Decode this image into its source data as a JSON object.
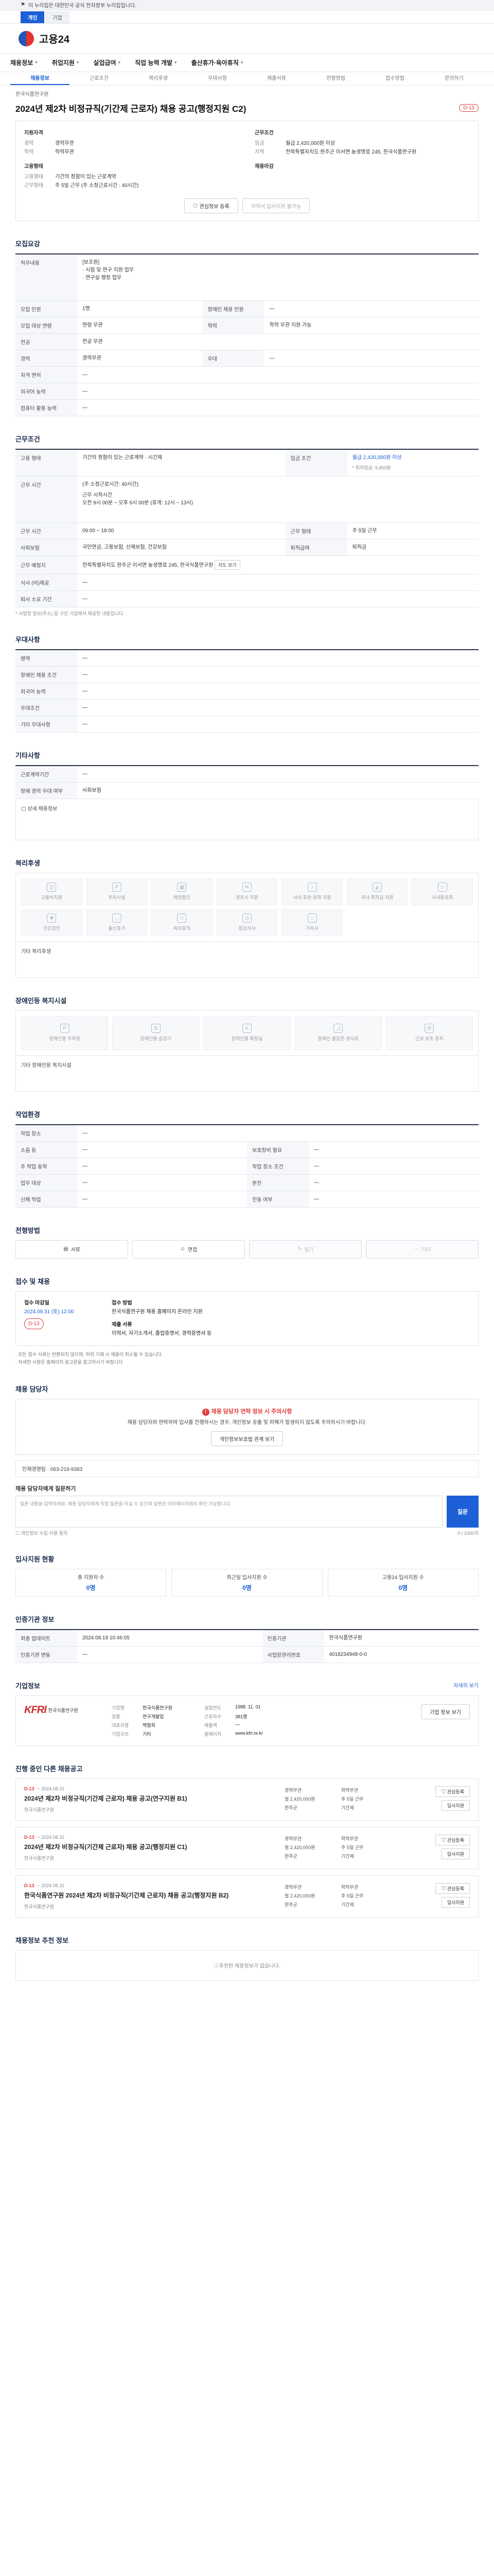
{
  "banner": {
    "text": "이 누리집은 대한민국 공식 전자정부 누리집입니다."
  },
  "util_tabs": [
    "개인",
    "기업"
  ],
  "header": {
    "logo": "고용24"
  },
  "gnb": [
    "채용정보",
    "취업지원",
    "실업급여",
    "직업 능력 개발",
    "출산휴가·육아휴직"
  ],
  "subtabs": [
    "채용정보",
    "근로조건",
    "복리후생",
    "우대사항",
    "제출서류",
    "전형방법",
    "접수방법",
    "문의하기"
  ],
  "posting": {
    "company_sm": "한국식품연구원",
    "title": "2024년 제2차 비정규직(기간제 근로자) 채용 공고(행정지원 C2)",
    "dday": "D-13"
  },
  "summary": {
    "left_label": "지원자격",
    "left": [
      {
        "k": "경력",
        "v": "경력무관"
      },
      {
        "k": "학력",
        "v": "학력무관"
      }
    ],
    "left2_label": "고용형태",
    "left2": [
      {
        "k": "고용형태",
        "v": "기간의 정함이 있는 근로계약"
      },
      {
        "k": "근무형태",
        "v": "주 5일 근무 (주 소정근로시간 : 40시간)"
      }
    ],
    "right_label": "근무조건",
    "right": [
      {
        "k": "임금",
        "v": "월급 2,420,000원 이상"
      },
      {
        "k": "지역",
        "v": "전북특별자치도 완주군 이서면 농생명로 245, 한국식품연구원"
      }
    ],
    "right2_label": "채용마감",
    "interest_btn": "관심정보 등록",
    "resume_btn": "이력서 입사지원 불가능"
  },
  "sections": {
    "recruit": "모집요강",
    "work": "근무조건",
    "prefer": "우대사항",
    "etc": "기타사항",
    "welfare": "복리후생",
    "disability": "장애인등 복지시설",
    "workplace": "작업환경",
    "selection": "전형방법",
    "apply": "접수 및 채용",
    "inquiry": "채용 담당자",
    "applicants": "입사지원 현황",
    "status": "인증기관 정보",
    "company": "기업정보",
    "other_jobs": "진행 중인 다른 채용공고",
    "recommend": "채용정보 추천 정보"
  },
  "recruit_table": [
    {
      "k": "직무내용",
      "v": "[보조원]\n· 시험 및 연구 지원 업무\n· 연구실 행정 업무"
    },
    {
      "k": "모집 인원",
      "v": "1명"
    },
    {
      "k": "모집 대상 연령",
      "v": "연령 무관"
    },
    {
      "k": "전공",
      "v": "전공 무관"
    },
    {
      "k": "경력",
      "v": "경력무관"
    },
    {
      "k": "자격 면허",
      "v": "—"
    },
    {
      "k": "외국어 능력",
      "v": "—"
    },
    {
      "k": "컴퓨터 활용 능력",
      "v": "—"
    }
  ],
  "recruit_right": [
    {
      "k": "장애인 채용 인원",
      "v": "—"
    },
    {
      "k": "학력",
      "v": "학력 무관 지원 가능"
    },
    {
      "k": "우대",
      "v": "—"
    }
  ],
  "work_table": [
    {
      "k": "고용 형태",
      "v": "기간의 정함이 있는 근로계약 · 시간제"
    },
    {
      "k": "임금 조건",
      "v": "월급 2,420,000원 이상"
    },
    {
      "k": "근무 예정지",
      "v": "전북특별자치도 완주군 이서면 농생명로 245, 한국식품연구원"
    },
    {
      "k": "근무 시간",
      "v": "09:00 ~ 18:00"
    },
    {
      "k": "근무 형태",
      "v": "주 5일 근무"
    },
    {
      "k": "사회보험",
      "v": "국민연금, 고용보험, 산재보험, 건강보험"
    },
    {
      "k": "퇴직급여",
      "v": "퇴직금"
    },
    {
      "k": "식사 (비)제공",
      "v": "—"
    },
    {
      "k": "퇴사 소요 기간",
      "v": "—"
    }
  ],
  "work_extra": {
    "pay_note": "* 최저임금: 9,860원",
    "schedule_note": "(주 소정근로시간: 40시간)",
    "time_detail": "근무 시작시간\n오전 9시 00분 ~ 오후 6시 00분 (휴게: 12시 ~ 13시)",
    "map_btn": "지도 보기",
    "footnote": "* 사업장 정보(주소) 등 구인 기업에서 제공한 내용입니다."
  },
  "prefer_table": [
    {
      "k": "병역",
      "v": "—"
    },
    {
      "k": "장애인 채용 조건",
      "v": "—"
    },
    {
      "k": "외국어 능력",
      "v": "—"
    },
    {
      "k": "우대조건",
      "v": "—"
    },
    {
      "k": "기타 우대사항",
      "v": "—"
    }
  ],
  "etc_table": [
    {
      "k": "근로계약기간",
      "v": "—"
    },
    {
      "k": "장애 경력 우대 여부",
      "v": "사회보험"
    }
  ],
  "etc_detail_label": "상세 채용정보",
  "welfare_items": [
    "교통비지원",
    "주차시설",
    "매장할인",
    "경조사 지원",
    "사내 휴양·문화 지원",
    "자녀 학자금 지원",
    "사내동호회",
    "건강검진",
    "출산휴가",
    "육아휴직",
    "점심식사",
    "기숙사"
  ],
  "welfare_etc": "기타 복리후생",
  "disability_items": [
    "장애인용 주차장",
    "장애인용 승강기",
    "장애인용 화장실",
    "장애인 출입문 경사로",
    "근로 보조 장치"
  ],
  "disability_etc": "기타 장애인용 복지시설",
  "workplace_table": [
    {
      "k": "작업 장소",
      "v": "—"
    },
    {
      "k": "소음 등",
      "v": "—"
    },
    {
      "k": "주 작업 동작",
      "v": "—"
    },
    {
      "k": "업무 대상",
      "v": "—"
    },
    {
      "k": "신체 작업",
      "v": "—"
    }
  ],
  "workplace_right": [
    {
      "k": "보호장비 필요",
      "v": "—"
    },
    {
      "k": "작업 장소 조건",
      "v": "—"
    },
    {
      "k": "분진",
      "v": "—"
    },
    {
      "k": "진동 여부",
      "v": "—"
    }
  ],
  "selection_buttons": [
    "서류",
    "면접",
    "필기",
    "기타"
  ],
  "apply": {
    "period_label": "접수 마감일",
    "period": "2024.08.31 (토) 12:00",
    "dday": "D-13",
    "method_label": "접수 방법",
    "method": "한국식품연구원 채용 홈페이지 온라인 지원",
    "docs_label": "제출 서류",
    "docs": "이력서, 자기소개서, 졸업증명서, 경력증명서 등",
    "bullets": [
      "· 모든 접수 서류는 반환되지 않으며, 허위 기재 시 채용이 취소될 수 있습니다.",
      "· 자세한 사항은 홈페이지 공고문을 참고하시기 바랍니다."
    ]
  },
  "inquiry": {
    "alert_title": "채용 담당자 연락 정보 시 주의사항",
    "alert_body": "채용 담당자와 연락하여 입사를 진행하시는 경우, 개인정보 유출 및 피해가 발생하지 않도록 주의하시기 바랍니다.",
    "alert_btn": "개인정보보호법 관계 보기",
    "contact": "인재경영팀 · 063-219-9383",
    "ask_label": "채용 담당자에게 질문하기",
    "ask_placeholder": "질문 내용을 입력하세요. 채용 담당자에게 직접 질문을 하실 수 있으며 답변은 마이페이지에서 확인 가능합니다.",
    "ask_btn": "질문",
    "count": "0 / 1000자",
    "terms": "개인정보 수집·이용 동의"
  },
  "applicants": [
    {
      "label": "총 지원자 수",
      "num": "0명"
    },
    {
      "label": "최근일 입사지원 수",
      "num": "0명"
    },
    {
      "label": "고용24 입사지원 수",
      "num": "0명"
    }
  ],
  "status_table": [
    {
      "k": "최종 업데이트",
      "v": "2024.08.19 10:46:05"
    },
    {
      "k": "인증기관 변동",
      "v": "—"
    }
  ],
  "status_right": [
    {
      "k": "인증기관",
      "v": "한국식품연구원"
    },
    {
      "k": "사업장관리번호",
      "v": "4018234948-0-0"
    }
  ],
  "company": {
    "mark": "KFRI",
    "name": "한국식품연구원",
    "more": "자세히 보기",
    "rows": [
      {
        "k": "기업명",
        "v": "한국식품연구원"
      },
      {
        "k": "설립연도",
        "v": "1988. 11. 01"
      },
      {
        "k": "업종",
        "v": "연구개발업"
      },
      {
        "k": "근로자수",
        "v": "381명"
      },
      {
        "k": "대표자명",
        "v": "백형희"
      },
      {
        "k": "매출액",
        "v": "—"
      },
      {
        "k": "기업규모",
        "v": "기타"
      },
      {
        "k": "홈페이지",
        "v": "www.kfri.re.kr"
      }
    ],
    "apply_btn": "기업 정보 보기"
  },
  "other_jobs": [
    {
      "dday": "D-13",
      "date": "~ 2024.08.31",
      "title": "2024년 제2차 비정규직(기간제 근로자) 채용 공고(연구지원 B1)",
      "company": "한국식품연구원",
      "info": [
        "경력무관",
        "학력무관",
        "월 2,420,000원",
        "주 5일 근무",
        "완주군",
        "기간제"
      ]
    },
    {
      "dday": "D-13",
      "date": "~ 2024.08.31",
      "title": "2024년 제2차 비정규직(기간제 근로자) 채용 공고(행정지원 C1)",
      "company": "한국식품연구원",
      "info": [
        "경력무관",
        "학력무관",
        "월 2,420,000원",
        "주 5일 근무",
        "완주군",
        "기간제"
      ]
    },
    {
      "dday": "D-13",
      "date": "~ 2024.08.31",
      "title": "한국식품연구원 2024년 제2차 비정규직(기간제 근로자) 채용 공고(행정지원 B2)",
      "company": "한국식품연구원",
      "info": [
        "경력무관",
        "학력무관",
        "월 2,420,000원",
        "주 5일 근무",
        "완주군",
        "기간제"
      ]
    }
  ],
  "other_jobs_labels": {
    "save": "관심등록",
    "apply": "입사지원",
    "more": "더보기 +"
  },
  "recommend_empty": "추천된 채용정보가 없습니다."
}
